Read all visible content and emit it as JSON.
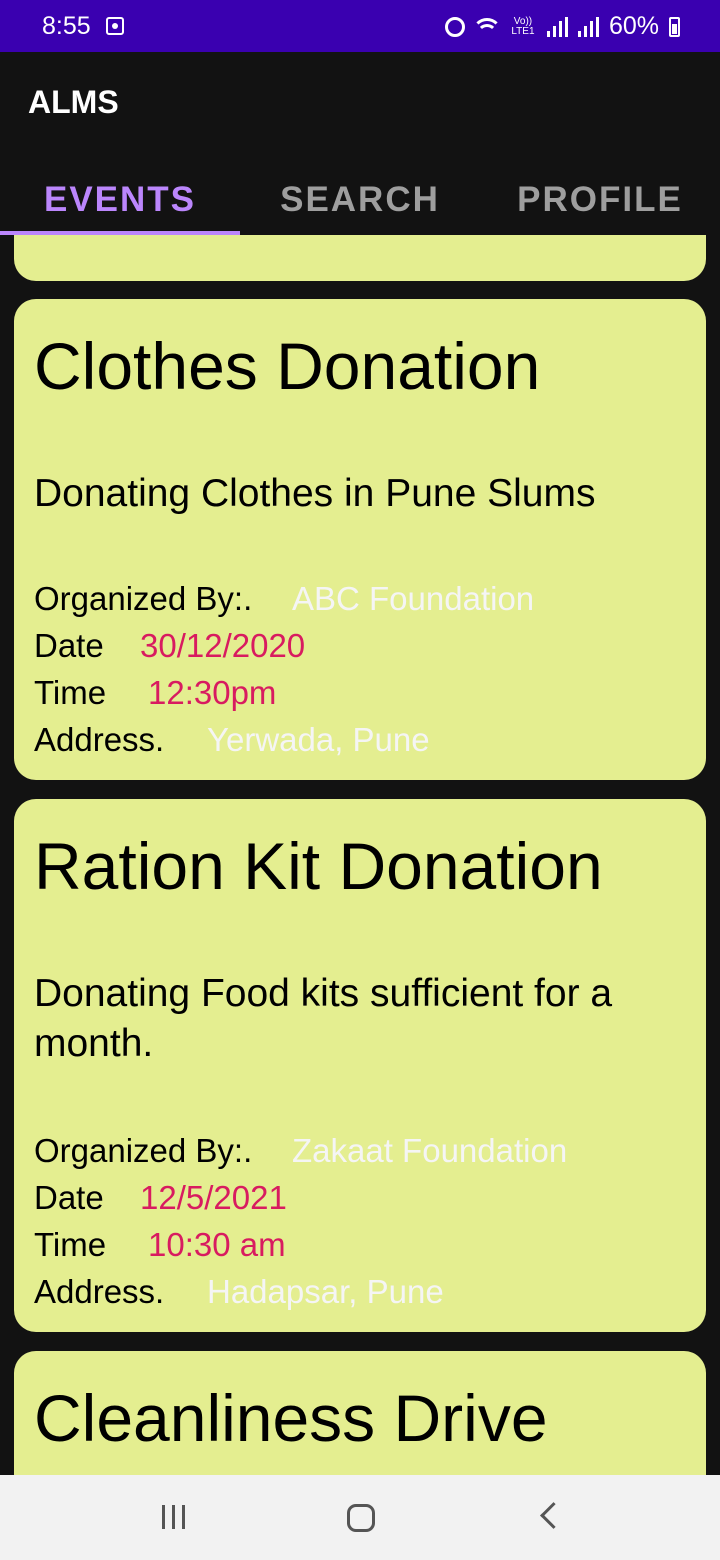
{
  "status_bar": {
    "time": "8:55",
    "lte_label": "Vo))\nLTE1",
    "battery": "60%"
  },
  "app": {
    "title": "ALMS"
  },
  "tabs": [
    {
      "label": "EVENTS",
      "active": true
    },
    {
      "label": "SEARCH",
      "active": false
    },
    {
      "label": "PROFILE",
      "active": false
    }
  ],
  "labels": {
    "organized_by": "Organized By:.",
    "date": "Date",
    "time": "Time",
    "address": "Address."
  },
  "events": [
    {
      "title": "Clothes Donation",
      "description": "Donating Clothes in Pune Slums",
      "organizer": "ABC Foundation",
      "date": "30/12/2020",
      "time": "12:30pm",
      "address": "Yerwada, Pune"
    },
    {
      "title": "Ration Kit Donation",
      "description": "Donating Food kits sufficient for a month.",
      "organizer": "Zakaat Foundation",
      "date": "12/5/2021",
      "time": "10:30 am",
      "address": "Hadapsar, Pune"
    },
    {
      "title": "Cleanliness Drive"
    }
  ],
  "colors": {
    "status_bar": "#3a00b0",
    "background": "#121212",
    "accent": "#bb86fc",
    "card": "#e4ee90",
    "value_pink": "#d81b60",
    "value_light": "#f5f5f5"
  }
}
